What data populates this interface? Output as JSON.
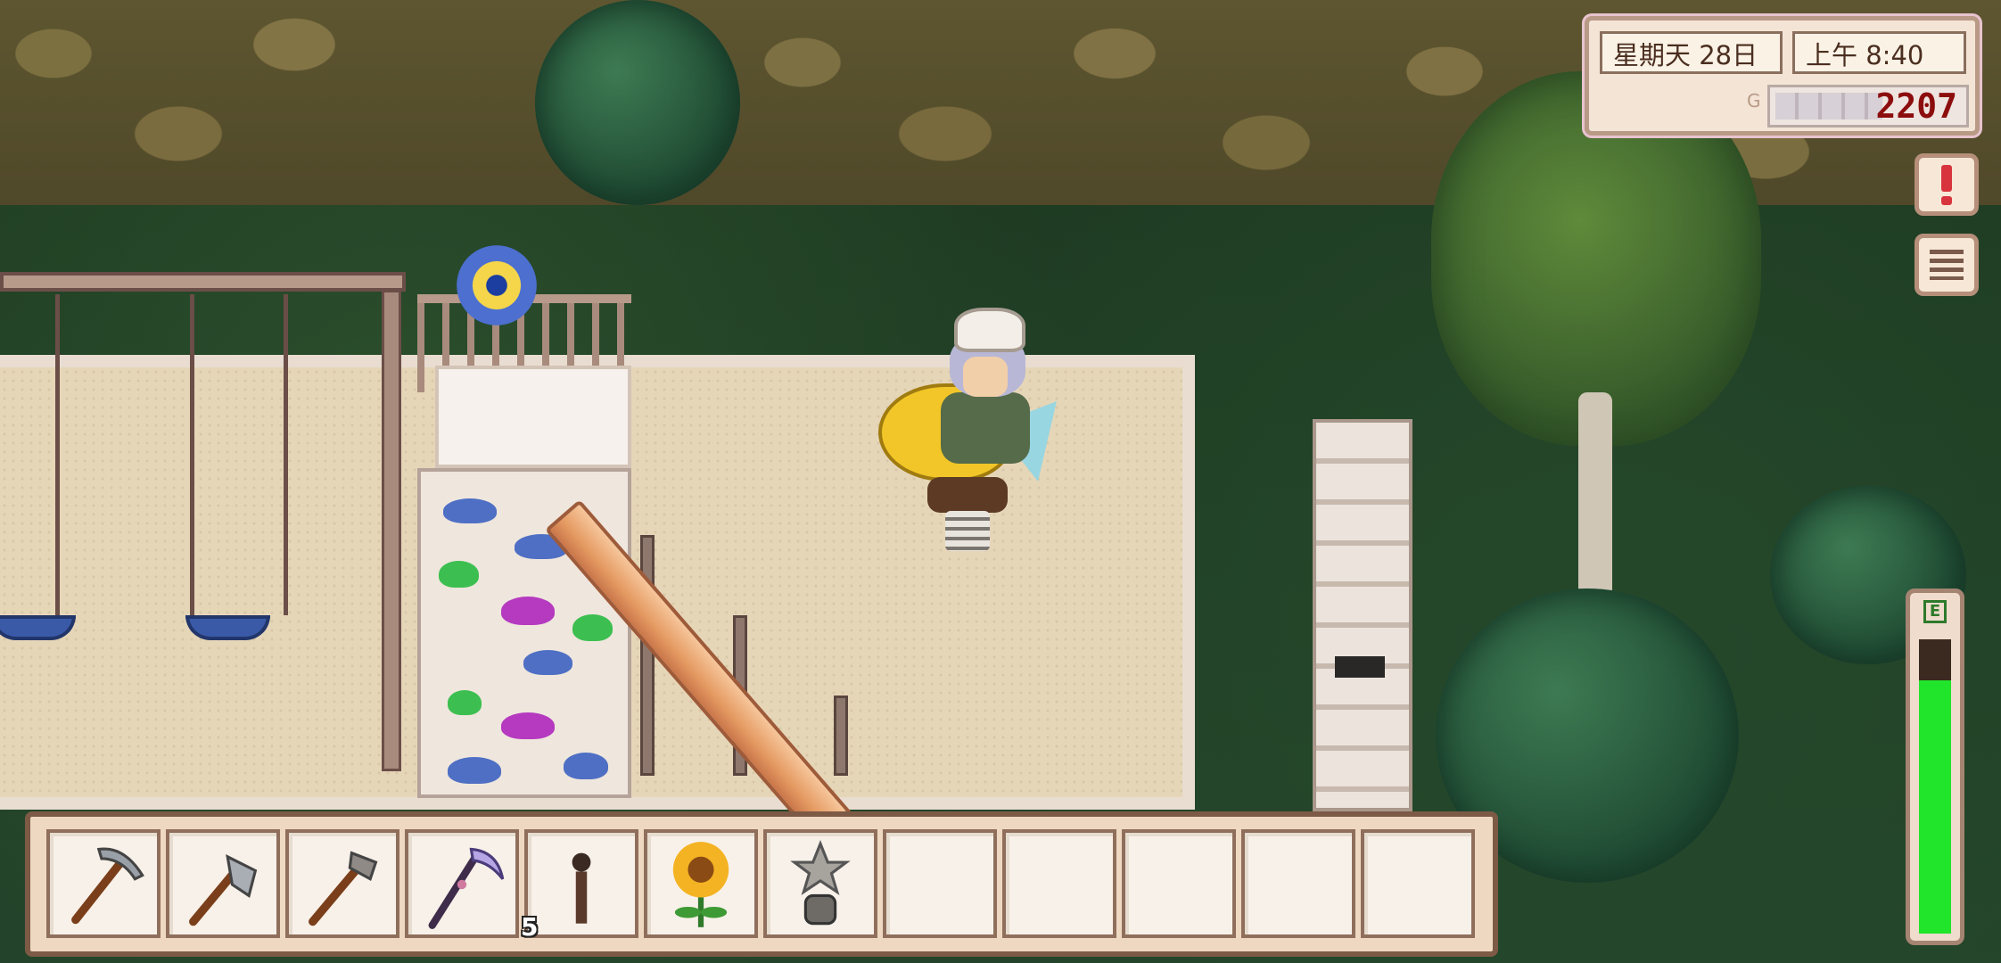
{
  "hud": {
    "date": "星期天 28日",
    "time": "上午 8:40",
    "gold": "2207",
    "gold_prefix": "G"
  },
  "energy": {
    "label": "E",
    "level_fraction": 0.86,
    "fill_color": "#21e52a"
  },
  "side_buttons": {
    "quest_icon": "exclamation-icon",
    "menu_icon": "hamburger-menu-icon"
  },
  "toolbar": {
    "slots": [
      {
        "item": "pickaxe",
        "count": ""
      },
      {
        "item": "axe",
        "count": ""
      },
      {
        "item": "hoe",
        "count": ""
      },
      {
        "item": "scythe",
        "count": ""
      },
      {
        "item": "torch",
        "count": "5"
      },
      {
        "item": "sunflower",
        "count": ""
      },
      {
        "item": "statue-trophy",
        "count": ""
      },
      {
        "item": "empty",
        "count": ""
      },
      {
        "item": "empty",
        "count": ""
      },
      {
        "item": "empty",
        "count": ""
      },
      {
        "item": "empty",
        "count": ""
      },
      {
        "item": "empty",
        "count": ""
      }
    ]
  }
}
